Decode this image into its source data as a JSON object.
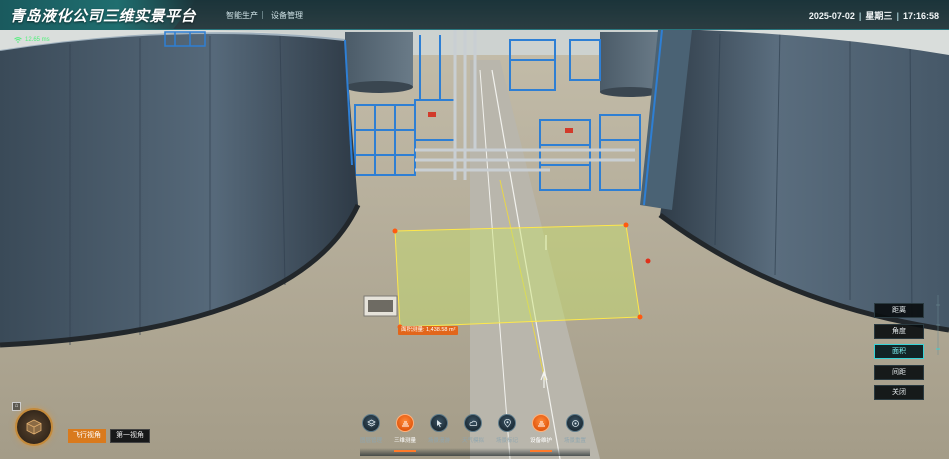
{
  "header": {
    "app_title": "青岛液化公司三维实景平台",
    "nav": [
      {
        "label": "智能生产"
      },
      {
        "label": "设备管理"
      }
    ],
    "date": "2025-07-02",
    "weekday": "星期三",
    "time": "17:16:58"
  },
  "network": {
    "icon": "wifi-icon",
    "latency": "12.65 ms",
    "color": "#4ff07a"
  },
  "measure_panel": {
    "items": [
      {
        "label": "距离",
        "active": false
      },
      {
        "label": "角度",
        "active": false
      },
      {
        "label": "面积",
        "active": true
      },
      {
        "label": "间距",
        "active": false
      },
      {
        "label": "关闭",
        "active": false
      }
    ]
  },
  "measurement": {
    "area_label": "面积测量: 1,438.58 m²",
    "fill_color": "#c7e36a",
    "border_color": "#ffe84a",
    "vertex_color": "#ff5a10"
  },
  "toolbar": {
    "tools": [
      {
        "label": "图层管理",
        "icon": "layers-icon",
        "active": false
      },
      {
        "label": "三维测量",
        "icon": "measure-icon",
        "active": true
      },
      {
        "label": "场景漫游",
        "icon": "cursor-icon",
        "active": false
      },
      {
        "label": "天气模拟",
        "icon": "weather-icon",
        "active": false
      },
      {
        "label": "场景标记",
        "icon": "marker-icon",
        "active": false
      },
      {
        "label": "设备维护",
        "icon": "maintenance-icon",
        "active": true
      },
      {
        "label": "场景重置",
        "icon": "reset-icon",
        "active": false
      }
    ],
    "accent": "#ff7a2a"
  },
  "view_controls": {
    "fly_view": "飞行视角",
    "first_person": "第一视角",
    "compass_icon": "cube-compass-icon",
    "home_icon": "home-icon"
  },
  "colors": {
    "header_bg": "#142e34",
    "accent_cyan": "#37d4d8",
    "accent_orange": "#e2661b"
  }
}
